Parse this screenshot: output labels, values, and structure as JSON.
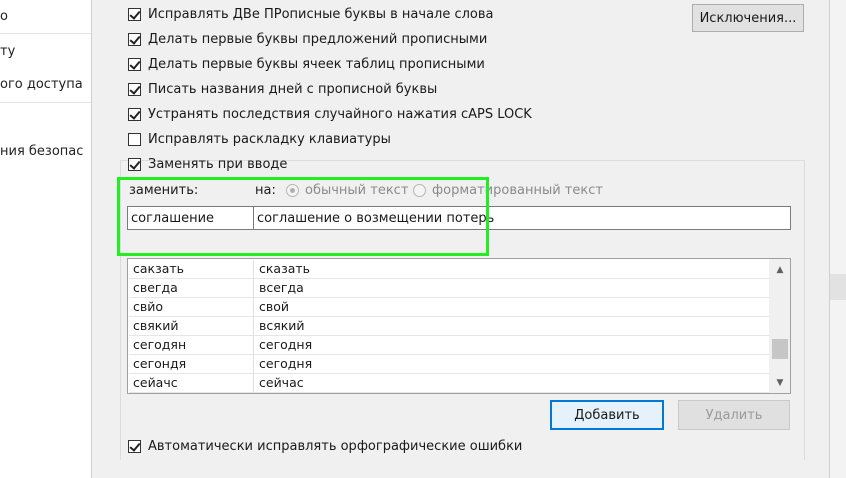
{
  "background_app": {
    "items": [
      "о",
      "ту",
      "ого доступа",
      "ния безопас"
    ]
  },
  "options": {
    "two_initial_caps": "Исправлять ДВе ПРописные буквы в начале слова",
    "capitalize_sentences": "Делать первые буквы предложений прописными",
    "capitalize_table_cells": "Делать первые буквы ячеек таблиц прописными",
    "capitalize_day_names": "Писать названия дней с прописной буквы",
    "caps_lock": "Устранять последствия случайного нажатия cAPS LOCK",
    "keyboard_layout": "Исправлять раскладку клавиатуры",
    "replace_as_you_type": "Заменять при вводе",
    "spelling": "Автоматически исправлять орфографические ошибки"
  },
  "checked": {
    "two_initial_caps": true,
    "capitalize_sentences": true,
    "capitalize_table_cells": true,
    "capitalize_day_names": true,
    "caps_lock": true,
    "keyboard_layout": false,
    "replace_as_you_type": true,
    "spelling": true
  },
  "buttons": {
    "exceptions": "Исключения...",
    "add": "Добавить",
    "delete": "Удалить"
  },
  "replace": {
    "replace_label": "заменить:",
    "with_label": "на:",
    "plain_text": "обычный текст",
    "formatted_text": "форматированный текст",
    "replace_value": "соглашение",
    "with_value": "соглашение о возмещении потерь"
  },
  "entries": [
    [
      "сакзать",
      "сказать"
    ],
    [
      "свегда",
      "всегда"
    ],
    [
      "свйо",
      "свой"
    ],
    [
      "свякий",
      "всякий"
    ],
    [
      "сегодян",
      "сегодня"
    ],
    [
      "сегондя",
      "сегодня"
    ],
    [
      "сейачс",
      "сейчас"
    ]
  ],
  "colors": {
    "highlight": "#22ee22",
    "primary_button_border": "#0078d7"
  }
}
